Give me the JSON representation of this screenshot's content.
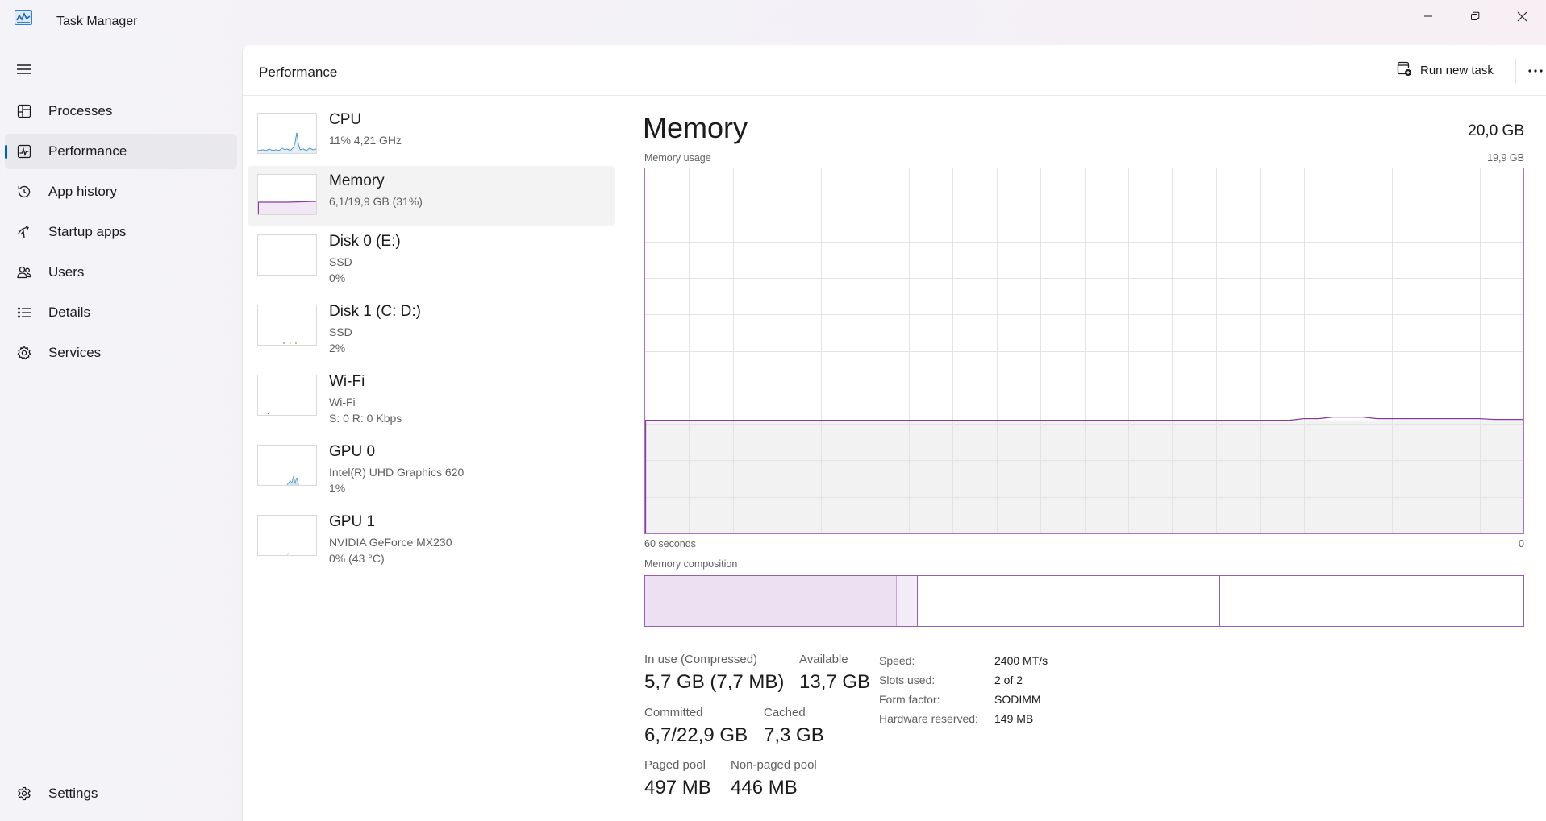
{
  "window": {
    "title": "Task Manager",
    "icon": "task-manager-icon",
    "controls": [
      "minimize-icon",
      "restore-icon",
      "close-icon"
    ]
  },
  "sidebar": {
    "menu_icon": "hamburger-icon",
    "items": [
      {
        "label": "Processes",
        "icon": "processes-icon"
      },
      {
        "label": "Performance",
        "icon": "performance-icon",
        "active": true
      },
      {
        "label": "App history",
        "icon": "history-icon"
      },
      {
        "label": "Startup apps",
        "icon": "startup-icon"
      },
      {
        "label": "Users",
        "icon": "users-icon"
      },
      {
        "label": "Details",
        "icon": "details-icon"
      },
      {
        "label": "Services",
        "icon": "services-icon"
      }
    ],
    "settings": {
      "label": "Settings",
      "icon": "gear-icon"
    }
  },
  "header": {
    "title": "Performance",
    "run_new_task": "Run new task",
    "run_icon": "run-task-icon",
    "more_icon": "more-icon"
  },
  "resources": [
    {
      "name": "CPU",
      "line1": "11%  4,21 GHz",
      "line2": "",
      "color": "#1a73b8"
    },
    {
      "name": "Memory",
      "line1": "6,1/19,9 GB (31%)",
      "line2": "",
      "color": "#8b3a9e",
      "active": true
    },
    {
      "name": "Disk 0 (E:)",
      "line1": "SSD",
      "line2": "0%",
      "color": "#4c9a2a"
    },
    {
      "name": "Disk 1 (C: D:)",
      "line1": "SSD",
      "line2": "2%",
      "color": "#4c9a2a"
    },
    {
      "name": "Wi-Fi",
      "line1": "Wi-Fi",
      "line2": "S: 0  R: 0 Kbps",
      "color": "#a35a2a"
    },
    {
      "name": "GPU 0",
      "line1": "Intel(R) UHD Graphics 620",
      "line2": "1%",
      "color": "#1a73b8"
    },
    {
      "name": "GPU 1",
      "line1": "NVIDIA GeForce MX230",
      "line2": "0%  (43 °C)",
      "color": "#1a73b8"
    }
  ],
  "detail": {
    "title": "Memory",
    "total": "20,0 GB",
    "usage_label": "Memory usage",
    "usage_max": "19,9 GB",
    "time_left": "60 seconds",
    "time_right": "0",
    "composition_label": "Memory composition",
    "accent": "#8b3a9e",
    "usage_fraction": 0.31,
    "stats": {
      "in_use_label": "In use (Compressed)",
      "in_use_value": "5,7 GB (7,7 MB)",
      "available_label": "Available",
      "available_value": "13,7 GB",
      "committed_label": "Committed",
      "committed_value": "6,7/22,9 GB",
      "cached_label": "Cached",
      "cached_value": "7,3 GB",
      "paged_label": "Paged pool",
      "paged_value": "497 MB",
      "nonpaged_label": "Non-paged pool",
      "nonpaged_value": "446 MB"
    },
    "specs": [
      {
        "label": "Speed:",
        "value": "2400 MT/s"
      },
      {
        "label": "Slots used:",
        "value": "2 of 2"
      },
      {
        "label": "Form factor:",
        "value": "SODIMM"
      },
      {
        "label": "Hardware reserved:",
        "value": "149 MB"
      }
    ]
  }
}
